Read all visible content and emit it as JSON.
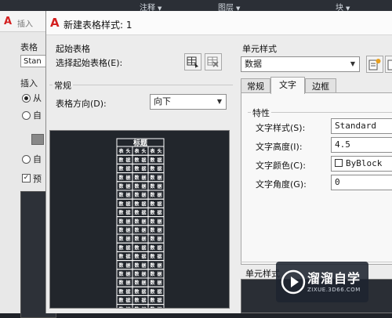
{
  "ribbon": {
    "items": [
      {
        "label": "注释"
      },
      {
        "label": "图层"
      },
      {
        "label": "块"
      }
    ]
  },
  "back_dialog": {
    "title": "插入",
    "table_label": "表格",
    "table_value": "Stan",
    "insert_label": "插入",
    "radio_from": "从",
    "radio_auto": "自",
    "radio_auto2": "自",
    "preview_check": "预"
  },
  "dialog": {
    "title": "新建表格样式: 1",
    "start_table": {
      "group_label": "起始表格",
      "select_label": "选择起始表格(E):"
    },
    "general": {
      "group_label": "常规",
      "direction_label": "表格方向(D):",
      "direction_value": "向下"
    },
    "preview": {
      "title": "标题",
      "header_cell": "表头",
      "data_cell": "数据"
    },
    "cell_style": {
      "group_label": "单元样式",
      "selected": "数据",
      "tabs": [
        {
          "label": "常规"
        },
        {
          "label": "文字"
        },
        {
          "label": "边框"
        }
      ],
      "active_tab": "文字",
      "properties_label": "特性",
      "text_style_label": "文字样式(S):",
      "text_style_value": "Standard",
      "text_height_label": "文字高度(I):",
      "text_height_value": "4.5",
      "text_color_label": "文字颜色(C):",
      "text_color_value": "ByBlock",
      "text_angle_label": "文字角度(G):",
      "text_angle_value": "0",
      "cell_preview_label": "单元样式"
    }
  },
  "watermark": {
    "main": "溜溜自学",
    "sub": "ZIXUE.3D66.COM"
  },
  "icons": {
    "logo": "autocad-logo-icon",
    "select_table": "select-table-icon",
    "delete_table": "delete-table-icon",
    "create_style": "create-cell-style-icon",
    "manage_style": "manage-cell-style-icon",
    "dropdown": "chevron-down-icon",
    "watermark": "play-logo-icon"
  }
}
